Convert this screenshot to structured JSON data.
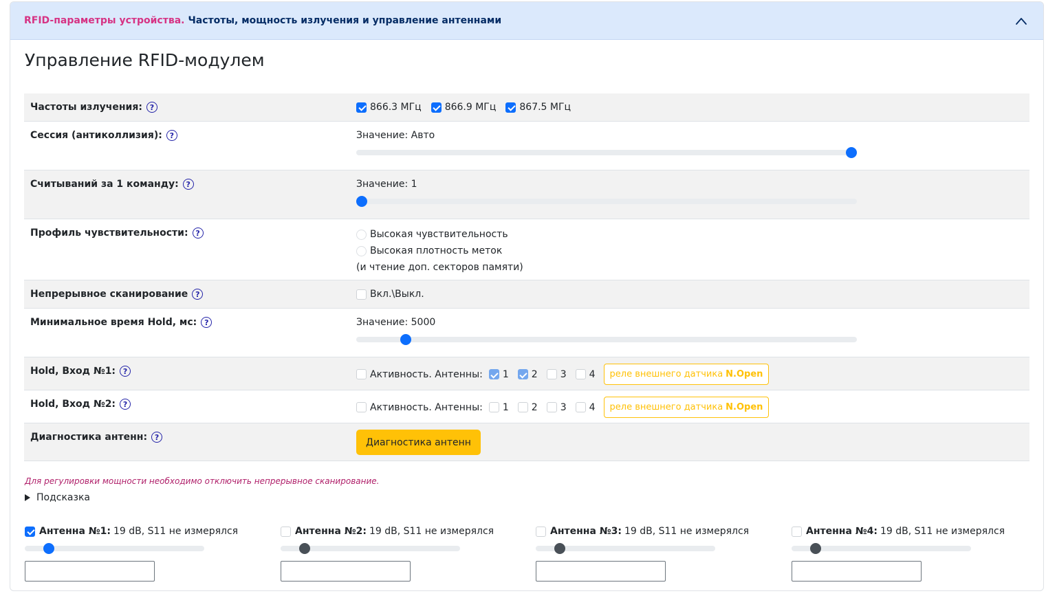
{
  "header": {
    "title_prefix": "RFID-параметры устройства.",
    "title_rest": "Частоты, мощность излучения и управление антеннами"
  },
  "page_title": "Управление RFID-модулем",
  "help_glyph": "?",
  "frequencies": {
    "label": "Частоты излучения:",
    "items": [
      {
        "label": "866.3 МГц",
        "checked": true
      },
      {
        "label": "866.9 МГц",
        "checked": true
      },
      {
        "label": "867.5 МГц",
        "checked": true
      }
    ]
  },
  "session": {
    "label": "Сессия (антиколлизия):",
    "value_text": "Значение: Авто",
    "slider_fraction": 1.0
  },
  "reads": {
    "label": "Считываний за 1 команду:",
    "value_text": "Значение: 1",
    "slider_fraction": 0.0
  },
  "sensitivity": {
    "label": "Профиль чувствительности:",
    "options": [
      "Высокая чувствительность",
      "Высокая плотность меток"
    ],
    "note": "(и чтение доп. секторов памяти)"
  },
  "continuous": {
    "label": "Непрерывное сканирование",
    "toggle_label": "Вкл.\\Выкл.",
    "checked": false
  },
  "hold_time": {
    "label": "Минимальное время Hold, мс:",
    "value_text": "Значение: 5000",
    "slider_fraction": 0.09
  },
  "hold_inputs": [
    {
      "label": "Hold, Вход №1:",
      "activity_label": "Активность. Антенны:",
      "antennas": [
        {
          "label": "1",
          "checked": true
        },
        {
          "label": "2",
          "checked": true
        },
        {
          "label": "3",
          "checked": false
        },
        {
          "label": "4",
          "checked": false
        }
      ],
      "relay_text": "реле внешнего датчика",
      "relay_mode": "N.Open"
    },
    {
      "label": "Hold, Вход №2:",
      "activity_label": "Активность. Антенны:",
      "antennas": [
        {
          "label": "1",
          "checked": false
        },
        {
          "label": "2",
          "checked": false
        },
        {
          "label": "3",
          "checked": false
        },
        {
          "label": "4",
          "checked": false
        }
      ],
      "relay_text": "реле внешнего датчика",
      "relay_mode": "N.Open"
    }
  ],
  "diagnostics": {
    "label": "Диагностика антенн:",
    "button_label": "Диагностика антенн"
  },
  "power_note": "Для регулировки мощности необходимо отключить непрерывное сканирование.",
  "hint_label": "Подсказка",
  "antennas": [
    {
      "name": "Антенна №1:",
      "info": "19 dB, S11 не измерялся",
      "enabled": true,
      "slider_fraction": 0.11,
      "input_value": ""
    },
    {
      "name": "Антенна №2:",
      "info": "19 dB, S11 не измерялся",
      "enabled": false,
      "slider_fraction": 0.11,
      "input_value": ""
    },
    {
      "name": "Антенна №3:",
      "info": "19 dB, S11 не измерялся",
      "enabled": false,
      "slider_fraction": 0.11,
      "input_value": ""
    },
    {
      "name": "Антенна №4:",
      "info": "19 dB, S11 не измерялся",
      "enabled": false,
      "slider_fraction": 0.11,
      "input_value": ""
    }
  ],
  "colors": {
    "accent": "#0d6efd",
    "warning": "#ffc107",
    "header_bg": "#dbe9fc",
    "header_prefix": "#d63384",
    "header_title": "#052c65",
    "note": "#b0206a"
  }
}
